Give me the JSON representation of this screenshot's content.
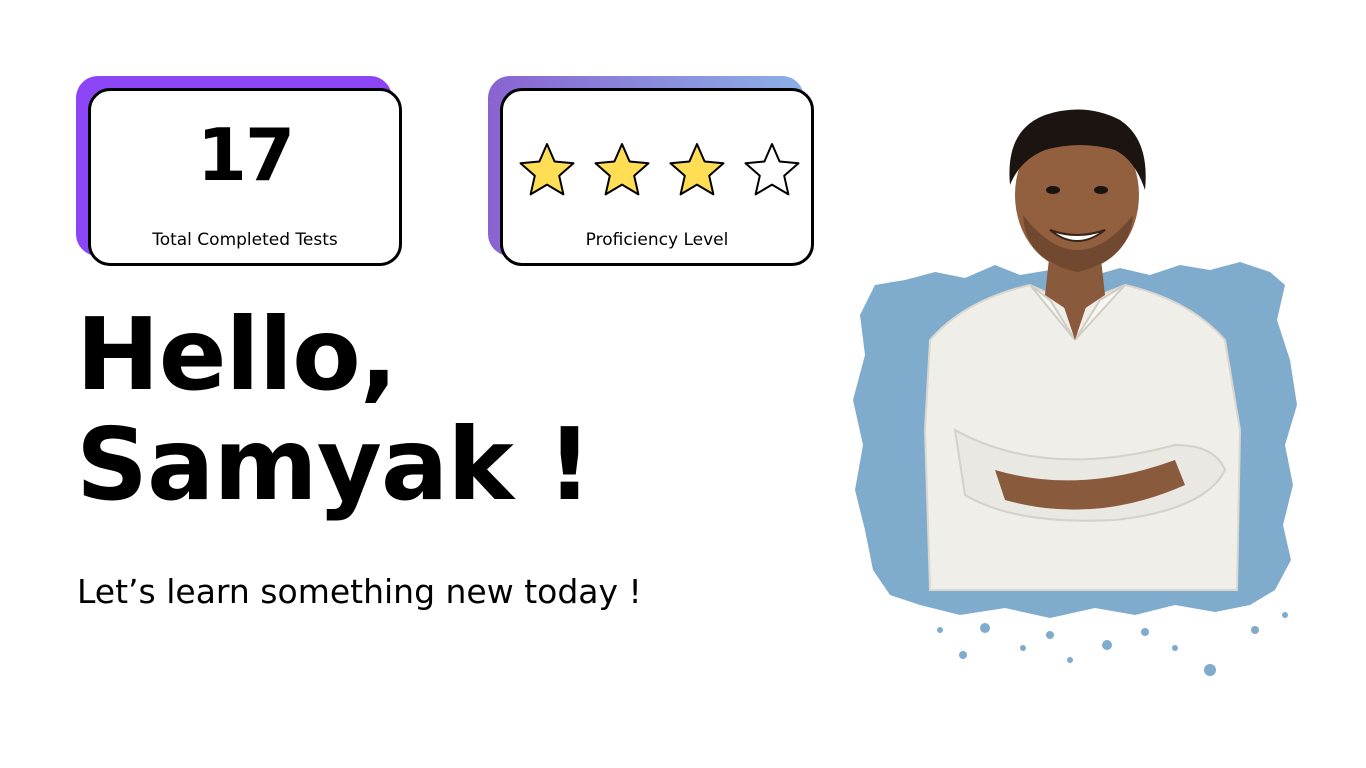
{
  "stats": {
    "completed_tests": {
      "value": "17",
      "label": "Total Completed Tests",
      "accent_color": "#8b45f5"
    },
    "proficiency": {
      "rating": 3,
      "max_rating": 5,
      "stars_shown": 4,
      "label": "Proficiency Level",
      "accent_colors": [
        "#8a63d2",
        "#8bb0e6"
      ],
      "star_fill_color": "#ffdd55"
    }
  },
  "greeting": {
    "line1": "Hello,",
    "line2": "Samyak !"
  },
  "subtext": "Let’s learn something new today !",
  "avatar": {
    "icon": "person-portrait-icon",
    "backdrop_color": "#7fabcd"
  }
}
